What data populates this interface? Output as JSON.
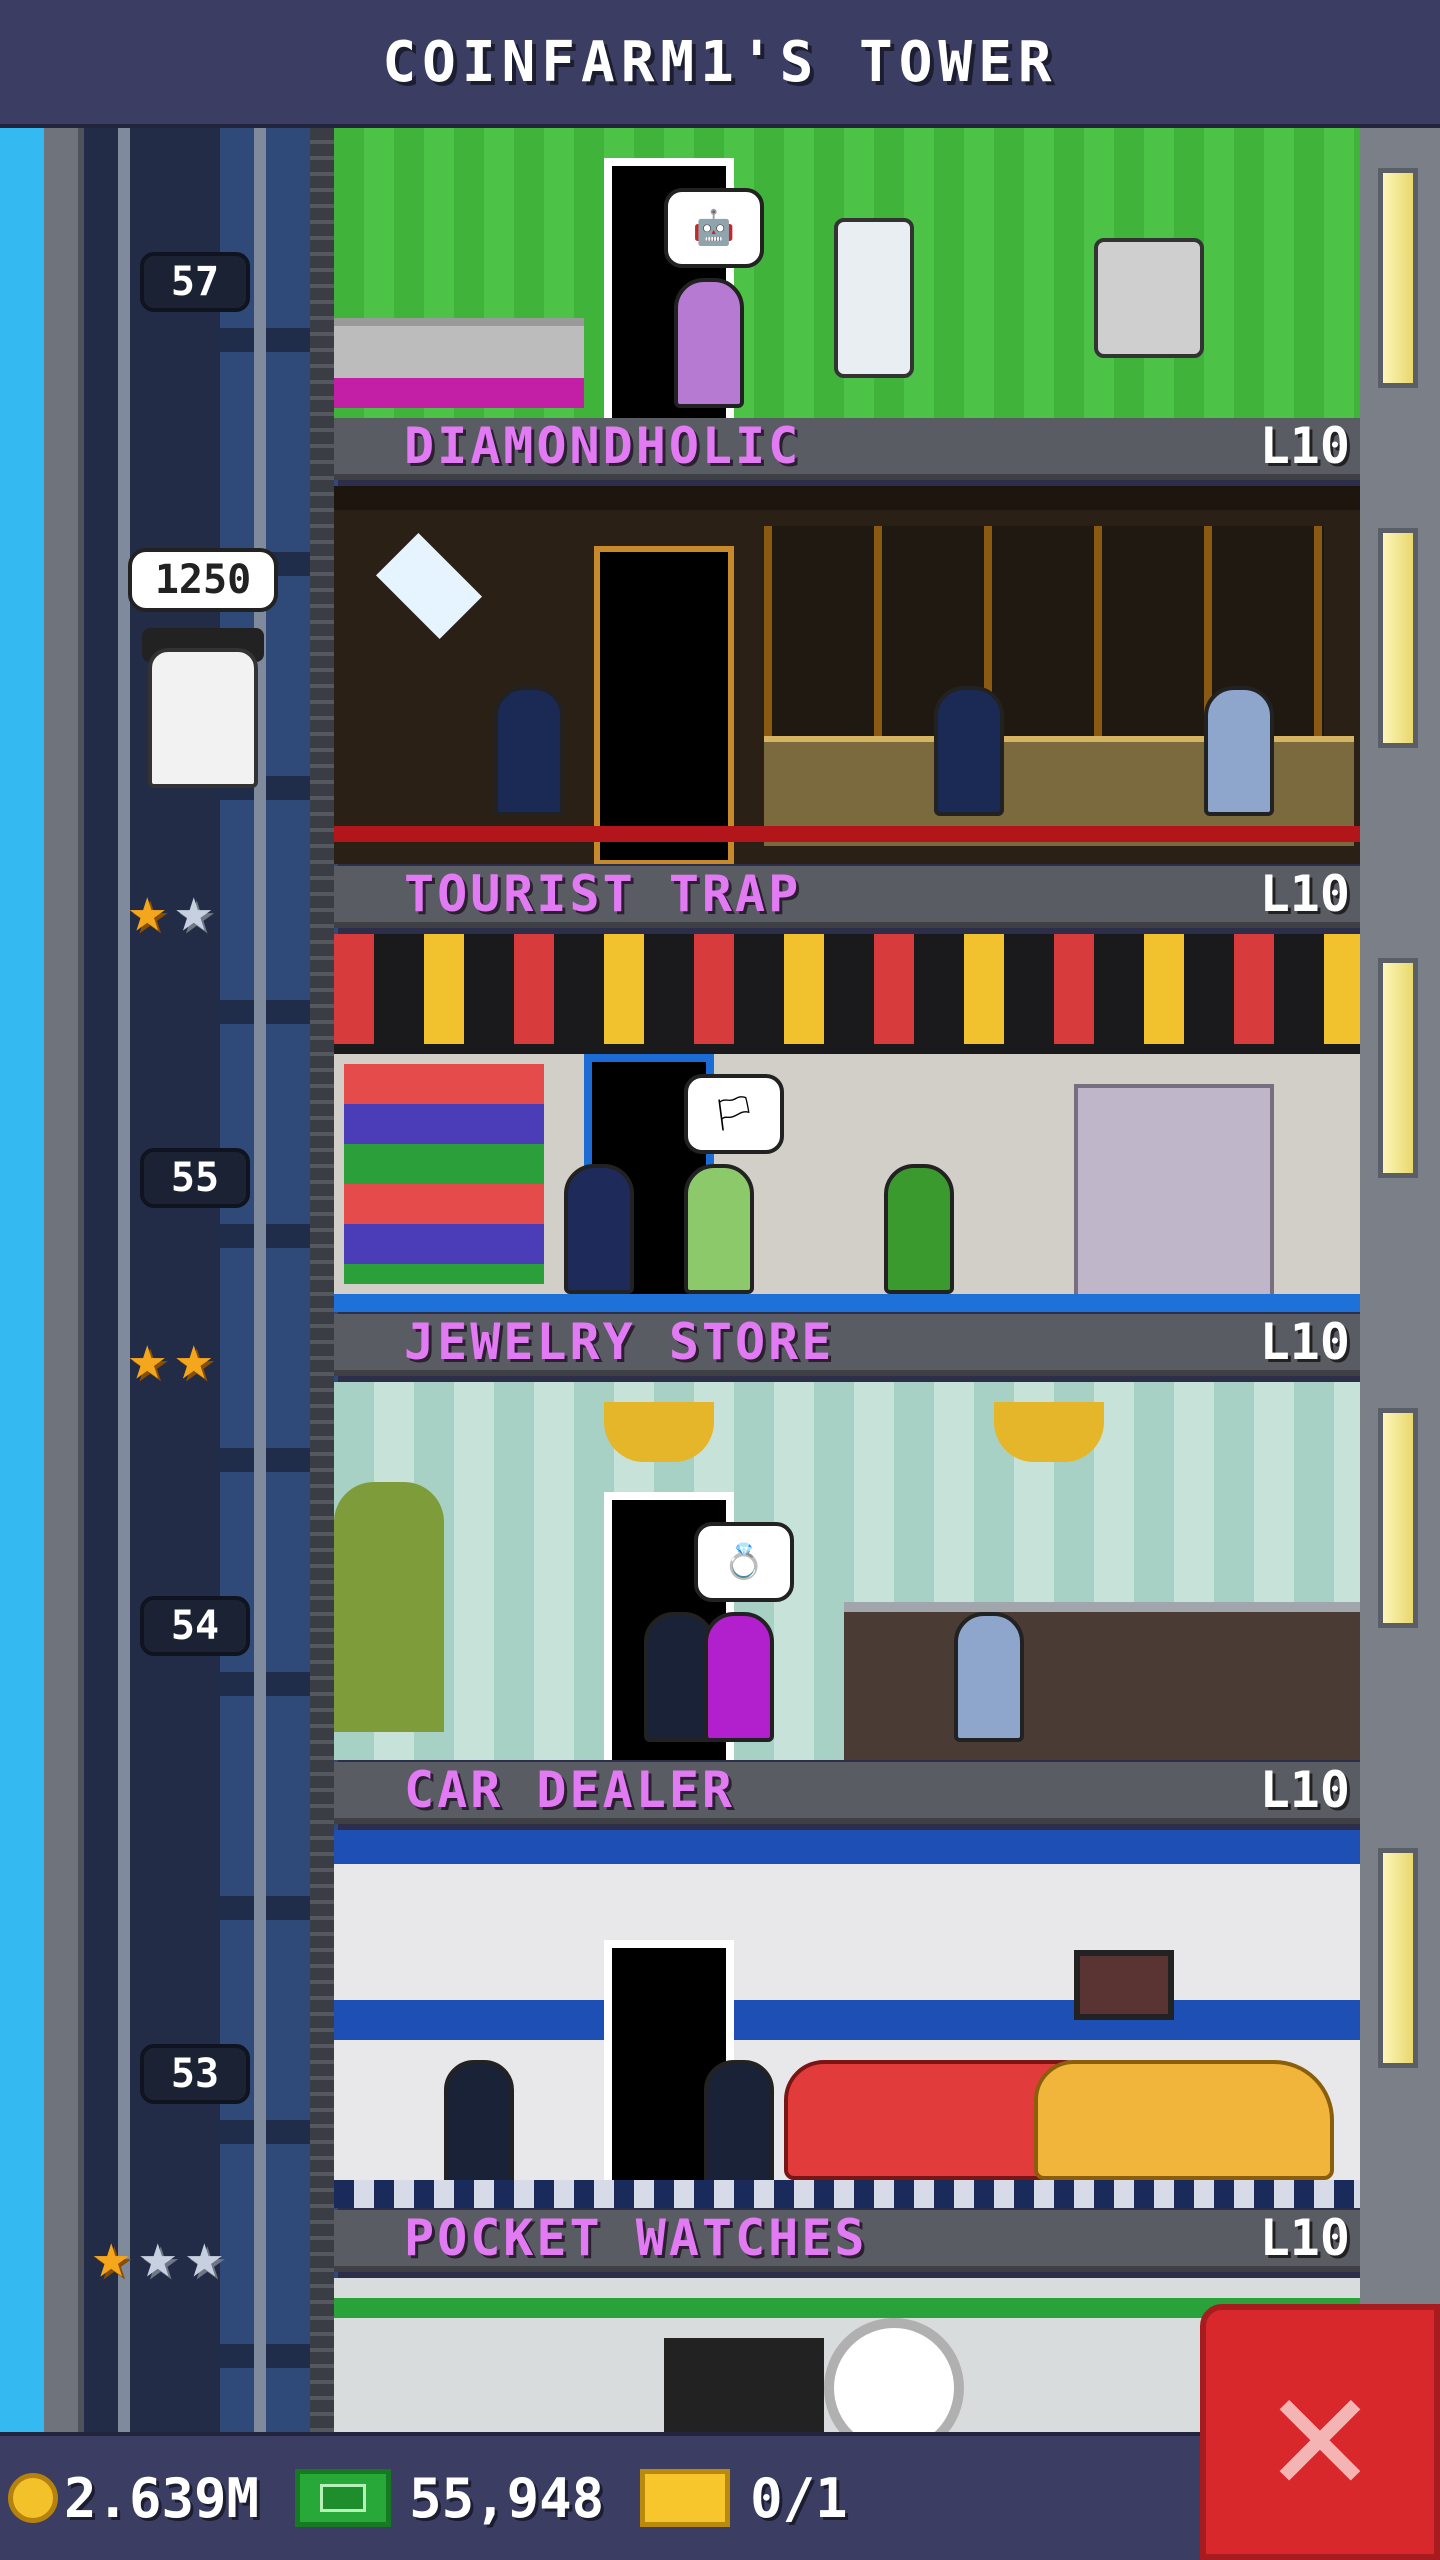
{
  "header": {
    "title": "COINFARM1'S TOWER"
  },
  "elevator": {
    "floor_labels": [
      "57",
      "55",
      "54",
      "53"
    ],
    "rider_bubble": "1250"
  },
  "floors": [
    {
      "name": "DIAMONDHOLIC",
      "level": "L10"
    },
    {
      "name": "TOURIST TRAP",
      "level": "L10"
    },
    {
      "name": "JEWELRY STORE",
      "level": "L10"
    },
    {
      "name": "CAR DEALER",
      "level": "L10"
    },
    {
      "name": "POCKET WATCHES",
      "level": "L10"
    }
  ],
  "stars": {
    "tourist_trap": {
      "gold": 1,
      "silver": 1
    },
    "jewelry_store": {
      "gold": 2,
      "silver": 0
    },
    "pocket_watches": {
      "gold": 1,
      "silver": 2
    }
  },
  "status": {
    "coins": "2.639M",
    "bux": "55,948",
    "tickets": "0/1"
  },
  "icons": {
    "coin": "coin-icon",
    "bux": "bux-icon",
    "ticket": "ticket-icon",
    "close": "close-icon"
  },
  "colors": {
    "floor_name": "#e27af3",
    "bar_bg": "#3b3d63",
    "close_button": "#d9282c",
    "star_gold": "#f4a61d",
    "star_silver": "#c7d0e0"
  }
}
